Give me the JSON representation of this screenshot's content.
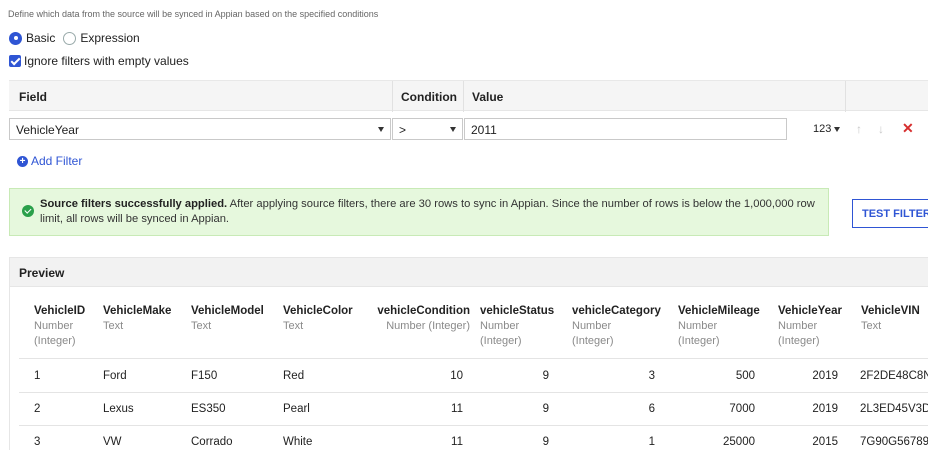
{
  "description": "Define which data from the source will be synced in Appian based on the specified conditions",
  "mode": {
    "options": [
      {
        "label": "Basic",
        "selected": true
      },
      {
        "label": "Expression",
        "selected": false
      }
    ]
  },
  "ignore_empty": {
    "label": "Ignore filters with empty values",
    "checked": true
  },
  "filter_table": {
    "headers": {
      "field": "Field",
      "condition": "Condition",
      "value": "Value"
    },
    "row": {
      "field": "VehicleYear",
      "condition": ">",
      "value": "2011",
      "type": "123"
    }
  },
  "add_filter": {
    "label": "Add Filter"
  },
  "banner": {
    "bold": "Source filters successfully applied.",
    "text": " After applying source filters, there are 30 rows to sync in Appian. Since the number of rows is below the 1,000,000 row limit, all rows will be synced in Appian.",
    "color": "#e6f8dd"
  },
  "test_filter": {
    "label": "TEST FILTER"
  },
  "preview": {
    "title": "Preview",
    "columns": [
      {
        "name": "VehicleID",
        "type": "Number (Integer)"
      },
      {
        "name": "VehicleMake",
        "type": "Text"
      },
      {
        "name": "VehicleModel",
        "type": "Text"
      },
      {
        "name": "VehicleColor",
        "type": "Text"
      },
      {
        "name": "vehicleCondition",
        "type": "Number (Integer)"
      },
      {
        "name": "vehicleStatus",
        "type": "Number (Integer)"
      },
      {
        "name": "vehicleCategory",
        "type": "Number (Integer)"
      },
      {
        "name": "VehicleMileage",
        "type": "Number (Integer)"
      },
      {
        "name": "VehicleYear",
        "type": "Number (Integer)"
      },
      {
        "name": "VehicleVIN",
        "type": "Text"
      }
    ],
    "type_lines": {
      "id": [
        "Number",
        "(Integer)"
      ],
      "make": [
        "Text"
      ],
      "model": [
        "Text"
      ],
      "color": [
        "Text"
      ],
      "condition": [
        "Number (Integer)"
      ],
      "status": [
        "Number",
        "(Integer)"
      ],
      "category": [
        "Number",
        "(Integer)"
      ],
      "mileage": [
        "Number",
        "(Integer)"
      ],
      "year": [
        "Number",
        "(Integer)"
      ],
      "vin": [
        "Text"
      ]
    },
    "rows": [
      [
        "1",
        "Ford",
        "F150",
        "Red",
        "10",
        "9",
        "3",
        "500",
        "2019",
        "2F2DE48C8N"
      ],
      [
        "2",
        "Lexus",
        "ES350",
        "Pearl",
        "11",
        "9",
        "6",
        "7000",
        "2019",
        "2L3ED45V3D"
      ],
      [
        "3",
        "VW",
        "Corrado",
        "White",
        "11",
        "9",
        "1",
        "25000",
        "2015",
        "7G90G56789"
      ]
    ]
  },
  "colors": {
    "accent": "#2f55d4",
    "delete": "#d62d2d"
  }
}
